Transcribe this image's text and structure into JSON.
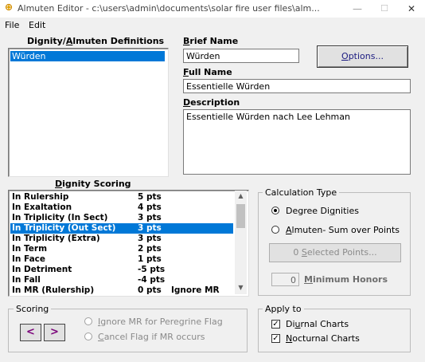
{
  "window": {
    "title": "Almuten Editor - c:\\users\\admin\\documents\\solar fire user files\\alm...",
    "app_icon_label": "Dignity",
    "minimize": "—",
    "maximize": "☐",
    "close": "✕"
  },
  "menu": [
    "File",
    "Edit"
  ],
  "definitions": {
    "title_prefix": "Dignity/",
    "title_underlined": "A",
    "title_suffix": "lmuten Definitions",
    "items": [
      "Würden"
    ]
  },
  "brief_name": {
    "label_underlined": "B",
    "label_rest": "rief Name",
    "value": "Würden"
  },
  "full_name": {
    "label_underlined": "F",
    "label_rest": "ull Name",
    "value": "Essentielle Würden"
  },
  "description": {
    "label_underlined": "D",
    "label_rest": "escription",
    "value": "Essentielle Würden nach Lee Lehman"
  },
  "options_button": {
    "underlined": "O",
    "rest": "ptions..."
  },
  "dignity_scoring": {
    "title_underlined": "D",
    "title_rest": "ignity Scoring",
    "rows": [
      {
        "name": "In Rulership",
        "pts": "5 pts",
        "extra": ""
      },
      {
        "name": "In Exaltation",
        "pts": "4 pts",
        "extra": ""
      },
      {
        "name": "In Triplicity (In Sect)",
        "pts": "3 pts",
        "extra": ""
      },
      {
        "name": "In Triplicity (Out Sect)",
        "pts": "3 pts",
        "extra": "",
        "selected": true
      },
      {
        "name": "In Triplicity (Extra)",
        "pts": "3 pts",
        "extra": ""
      },
      {
        "name": "In Term",
        "pts": "2 pts",
        "extra": ""
      },
      {
        "name": "In Face",
        "pts": "1 pts",
        "extra": ""
      },
      {
        "name": "In Detriment",
        "pts": "-5 pts",
        "extra": ""
      },
      {
        "name": "In Fall",
        "pts": "-4 pts",
        "extra": ""
      },
      {
        "name": "In MR (Rulership)",
        "pts": "0 pts",
        "extra": "Ignore MR"
      }
    ]
  },
  "calculation_type": {
    "title": "Calculation Type",
    "degree_dignities": "Degree Di",
    "degree_dignities_u": "g",
    "degree_dignities_rest": "nities",
    "almuten_u": "A",
    "almuten_rest": "lmuten- Sum over Points",
    "selected_points_prefix": "0 ",
    "selected_points_u": "S",
    "selected_points_rest": "elected Points...",
    "min_honors_value": "0",
    "min_honors_u": "M",
    "min_honors_rest": "inimum Honors"
  },
  "scoring": {
    "title": "Scoring",
    "prev": "<",
    "next": ">",
    "ignore_mr_u": "I",
    "ignore_mr_rest": "gnore MR for Peregrine Flag",
    "cancel_flag_u": "C",
    "cancel_flag_rest": "ancel Flag if MR occurs"
  },
  "apply_to": {
    "title": "Apply to",
    "diurnal_pre": "Di",
    "diurnal_u": "u",
    "diurnal_rest": "rnal Charts",
    "nocturnal_u": "N",
    "nocturnal_rest": "octurnal Charts",
    "check_mark": "✓"
  }
}
